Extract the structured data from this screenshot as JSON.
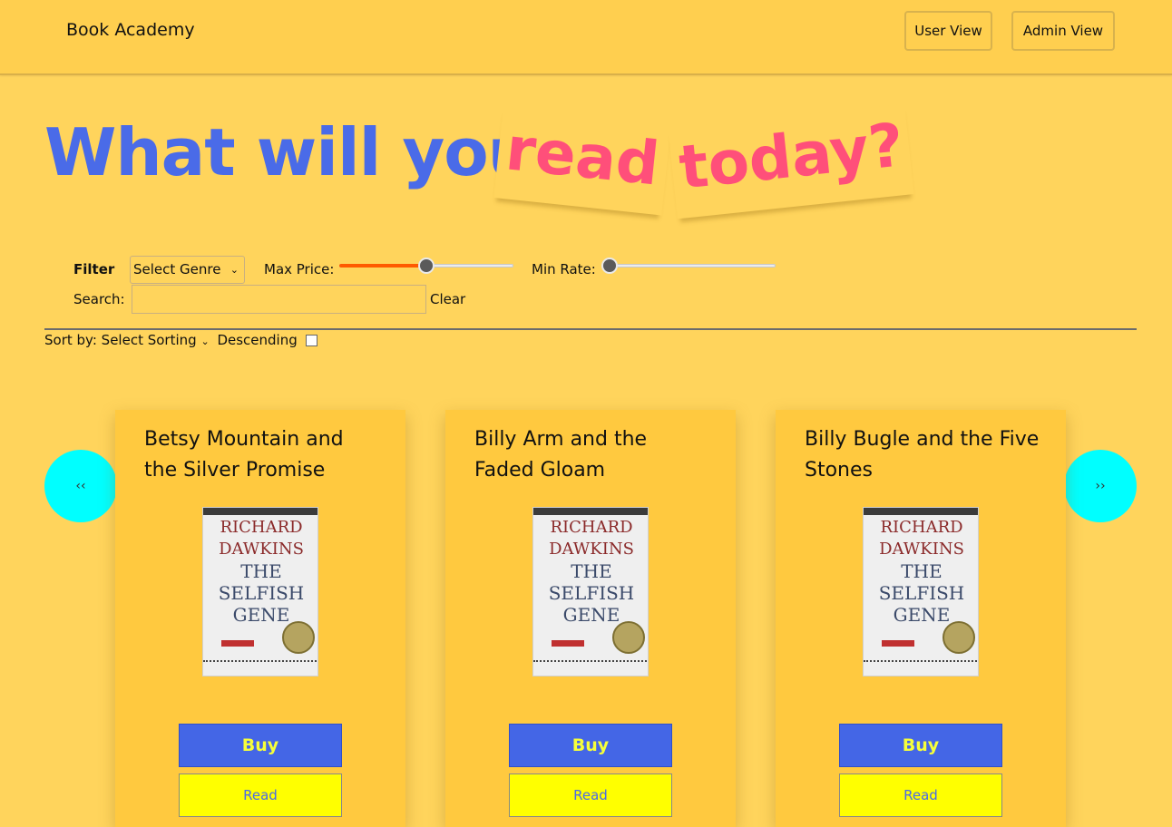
{
  "header": {
    "brand": "Book Academy",
    "nav": {
      "user_view": "User View",
      "admin_view": "Admin View"
    }
  },
  "hero": {
    "main": "What will you",
    "word1": "read",
    "word2": "today?"
  },
  "filters": {
    "filter_label": "Filter",
    "genre_select": "Select Genre",
    "max_price_label": "Max Price:",
    "max_price_level": 0.5,
    "min_rate_label": "Min Rate:",
    "min_rate_level": 0.0,
    "search_label": "Search:",
    "search_value": "",
    "clear_label": "Clear"
  },
  "sorting": {
    "label": "Sort by:",
    "select": "Select Sorting",
    "descending_label": "Descending",
    "descending_checked": false
  },
  "carousel": {
    "prev_label": "‹‹",
    "next_label": "››",
    "books": [
      {
        "title": "Betsy Mountain and the Silver Promise",
        "buy": "Buy",
        "read": "Read"
      },
      {
        "title": "Billy Arm and the Faded Gloam",
        "buy": "Buy",
        "read": "Read"
      },
      {
        "title": "Billy Bugle and the Five Stones",
        "buy": "Buy",
        "read": "Read"
      }
    ],
    "cover": {
      "author": "RICHARD DAWKINS",
      "title": "THE SELFISH GENE"
    }
  },
  "colors": {
    "background": "#ffd45c",
    "hero_blue": "#4a6be8",
    "hero_pink": "#ff4f7a",
    "arrow": "#00ffff",
    "buy_bg": "#4466e6",
    "read_bg": "#ffff00"
  }
}
